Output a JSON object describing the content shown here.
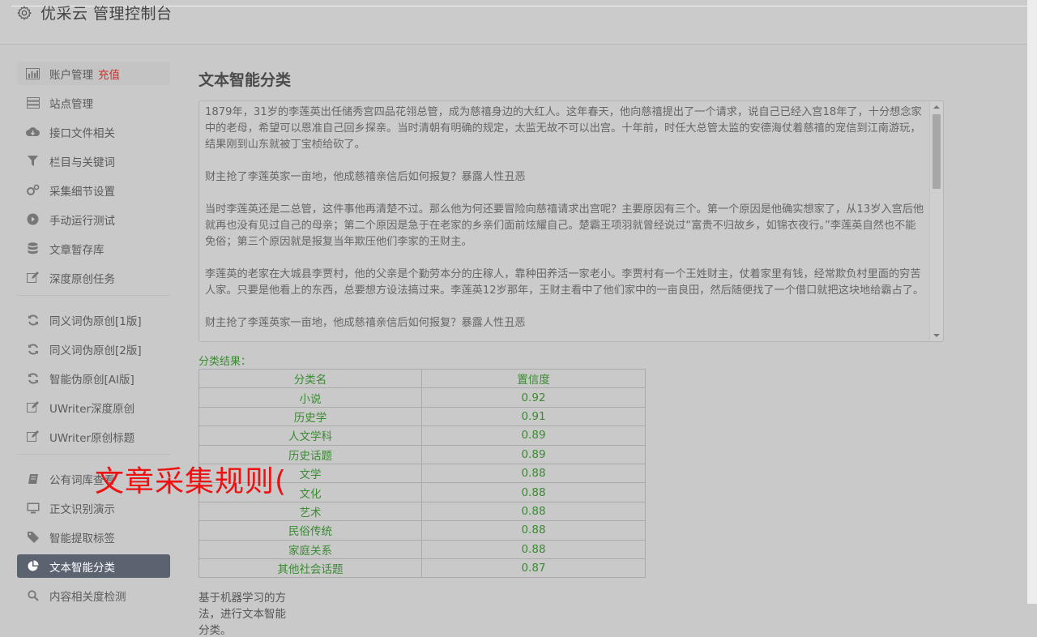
{
  "header": {
    "title": "优采云 管理控制台"
  },
  "sidebar": {
    "group1": [
      {
        "label": "账户管理",
        "extra": "充值",
        "icon": "bar-chart-icon"
      },
      {
        "label": "站点管理",
        "icon": "server-icon"
      },
      {
        "label": "接口文件相关",
        "icon": "cloud-download-icon"
      },
      {
        "label": "栏目与关键词",
        "icon": "filter-icon"
      },
      {
        "label": "采集细节设置",
        "icon": "gears-icon"
      },
      {
        "label": "手动运行测试",
        "icon": "play-circle-icon"
      },
      {
        "label": "文章暂存库",
        "icon": "database-icon"
      },
      {
        "label": "深度原创任务",
        "icon": "edit-icon"
      }
    ],
    "group2": [
      {
        "label": "同义词伪原创[1版]",
        "icon": "refresh-icon"
      },
      {
        "label": "同义词伪原创[2版]",
        "icon": "refresh-icon"
      },
      {
        "label": "智能伪原创[AI版]",
        "icon": "refresh-icon"
      },
      {
        "label": "UWriter深度原创",
        "icon": "edit-icon"
      },
      {
        "label": "UWriter原创标题",
        "icon": "edit-icon"
      }
    ],
    "group3": [
      {
        "label": "公有词库查看",
        "icon": "book-icon"
      },
      {
        "label": "正文识别演示",
        "icon": "desktop-icon"
      },
      {
        "label": "智能提取标签",
        "icon": "tag-icon"
      },
      {
        "label": "文本智能分类",
        "icon": "pie-chart-icon"
      },
      {
        "label": "内容相关度检测",
        "icon": "search-icon"
      }
    ]
  },
  "main": {
    "title": "文本智能分类",
    "text_paragraphs": [
      "1879年，31岁的李莲英出任储秀宫四品花翎总管，成为慈禧身边的大红人。这年春天，他向慈禧提出了一个请求，说自己已经入宫18年了，十分想念家中的老母，希望可以恩准自己回乡探亲。当时清朝有明确的规定，太监无故不可以出宫。十年前，时任大总管太监的安德海仗着慈禧的宠信到江南游玩，结果刚到山东就被丁宝桢给砍了。",
      "财主抢了李莲英家一亩地，他成慈禧亲信后如何报复？暴露人性丑恶",
      "当时李莲英还是二总管，这件事他再清楚不过。那么他为何还要冒险向慈禧请求出宫呢？主要原因有三个。第一个原因是他确实想家了，从13岁入宫后他就再也没有见过自己的母亲；第二个原因是急于在老家的乡亲们面前炫耀自己。楚霸王项羽就曾经说过“富贵不归故乡，如锦衣夜行。”李莲英自然也不能免俗；第三个原因就是报复当年欺压他们李家的王财主。",
      "李莲英的老家在大城县李贾村，他的父亲是个勤劳本分的庄稼人，靠种田养活一家老小。李贾村有一个王姓财主，仗着家里有钱，经常欺负村里面的穷苦人家。只要是他看上的东西，总要想方设法搞过来。李莲英12岁那年，王财主看中了他们家中的一亩良田，然后随便找了一个借口就把这块地给霸占了。",
      "财主抢了李莲英家一亩地，他成慈禧亲信后如何报复？暴露人性丑恶"
    ],
    "result_label": "分类结果：",
    "table": {
      "headers": [
        "分类名",
        "置信度"
      ],
      "rows": [
        [
          "小说",
          "0.92"
        ],
        [
          "历史学",
          "0.91"
        ],
        [
          "人文学科",
          "0.89"
        ],
        [
          "历史话题",
          "0.89"
        ],
        [
          "文学",
          "0.88"
        ],
        [
          "文化",
          "0.88"
        ],
        [
          "艺术",
          "0.88"
        ],
        [
          "民俗传统",
          "0.88"
        ],
        [
          "家庭关系",
          "0.88"
        ],
        [
          "其他社会话题",
          "0.87"
        ]
      ]
    },
    "footnote": "基于机器学习的方法，进行文本智能分类。"
  },
  "overlay": {
    "text": "文章采集规则("
  },
  "colors": {
    "active_bg": "#5c6370",
    "result_green": "#3a8a32",
    "overlay_red": "#ee1111",
    "recharge_red": "#c9302c"
  }
}
